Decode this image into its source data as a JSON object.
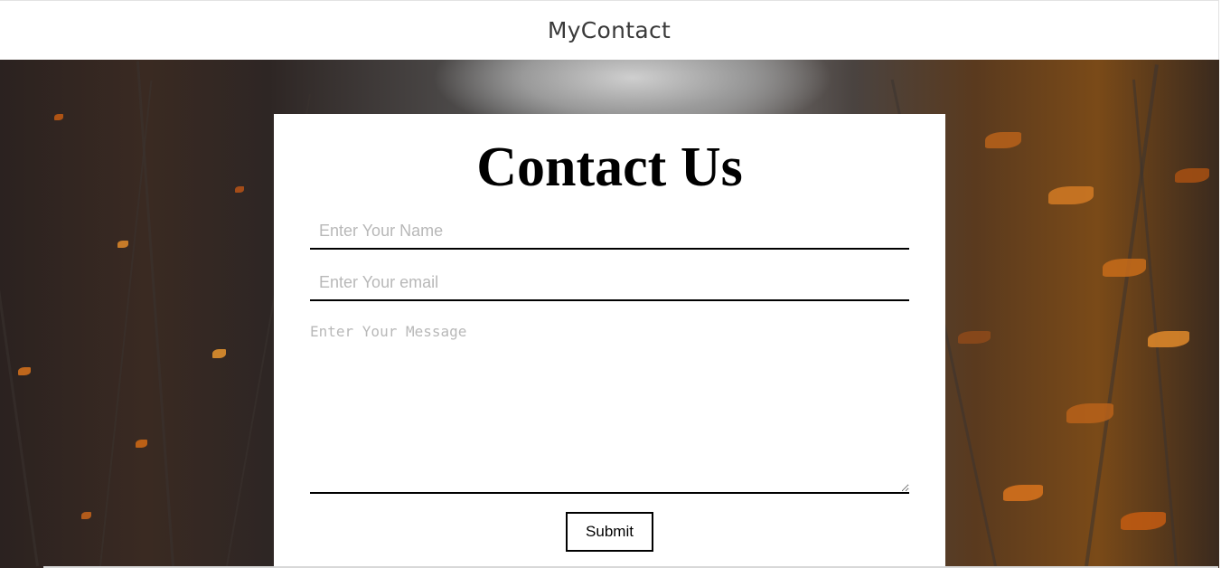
{
  "header": {
    "brand": "MyContact"
  },
  "contact_form": {
    "title": "Contact Us",
    "name_placeholder": "Enter Your Name",
    "name_value": "",
    "email_placeholder": "Enter Your email",
    "email_value": "",
    "message_placeholder": "Enter Your Message",
    "message_value": "",
    "submit_label": "Submit"
  }
}
